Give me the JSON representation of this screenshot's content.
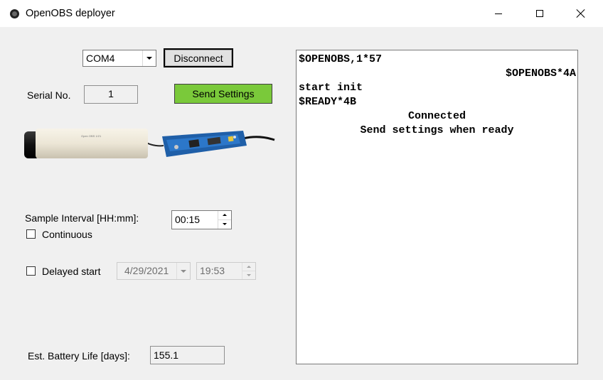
{
  "window": {
    "title": "OpenOBS deployer",
    "controls": {
      "minimize": "minimize-icon",
      "maximize": "maximize-icon",
      "close": "close-icon"
    }
  },
  "connection": {
    "port_selected": "COM4",
    "disconnect_label": "Disconnect"
  },
  "serial": {
    "label": "Serial No.",
    "value": "1"
  },
  "send_settings": {
    "label": "Send Settings",
    "color": "#7ac93a"
  },
  "device_image": {
    "icon": "openobs-sensor-image",
    "body_text": "Open OBS 1/21"
  },
  "sample_interval": {
    "label": "Sample Interval [HH:mm]:",
    "value": "00:15",
    "continuous_label": "Continuous",
    "continuous_checked": false
  },
  "delayed_start": {
    "label": "Delayed start",
    "checked": false,
    "date": "4/29/2021",
    "time": "19:53"
  },
  "battery": {
    "label": "Est. Battery Life [days]:",
    "value": "155.1"
  },
  "serial_log": {
    "lines": [
      {
        "text": "$OPENOBS,1*57",
        "align": "left"
      },
      {
        "text": "$OPENOBS*4A",
        "align": "right"
      },
      {
        "text": "start init",
        "align": "left"
      },
      {
        "text": "$READY*4B",
        "align": "left"
      },
      {
        "text": "Connected",
        "align": "center"
      },
      {
        "text": "Send settings when ready",
        "align": "center"
      }
    ]
  }
}
